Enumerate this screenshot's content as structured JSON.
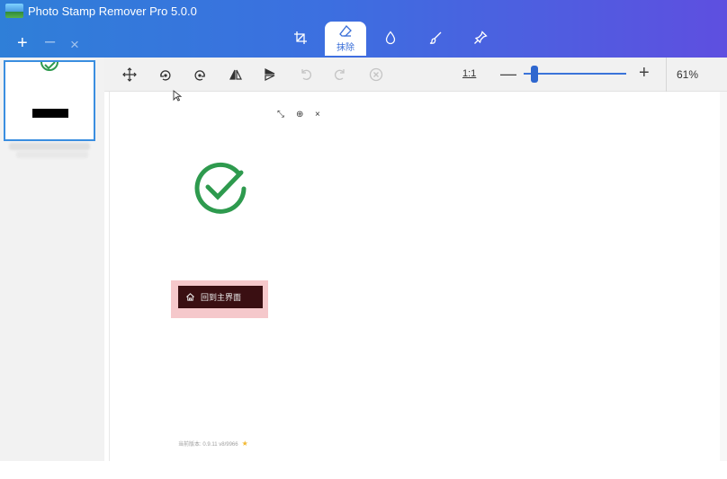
{
  "window": {
    "title": "Photo Stamp Remover Pro 5.0.0",
    "tab_controls": [
      "+",
      "–",
      "×"
    ]
  },
  "mode_tools": [
    {
      "icon": "crop-icon"
    },
    {
      "icon": "eraser-icon",
      "label": "抹除",
      "active": true
    },
    {
      "icon": "drop-icon"
    },
    {
      "icon": "brush-icon"
    },
    {
      "icon": "stamp-icon"
    }
  ],
  "toolbar": {
    "tools": [
      "move-icon",
      "rotate-left-icon",
      "rotate-right-icon",
      "flip-horizontal-icon",
      "flip-vertical-icon",
      "undo-icon",
      "redo-icon",
      "clear-icon"
    ],
    "ratio_label": "1:1",
    "zoom_minus": "—",
    "zoom_plus": "+",
    "zoom_percent": "61%",
    "zoom_level": 0.09
  },
  "canvas": {
    "dialog_controls": [
      "⤡",
      "⊕",
      "×"
    ],
    "home_button_label": "回到主界面",
    "version_text": "当前版本: 0.9.11 v8/9966"
  },
  "colors": {
    "accent": "#3a6fd8",
    "check_green": "#2e9a4e",
    "highlight": "#f5c8cb",
    "button_dark": "#3a0f12"
  }
}
